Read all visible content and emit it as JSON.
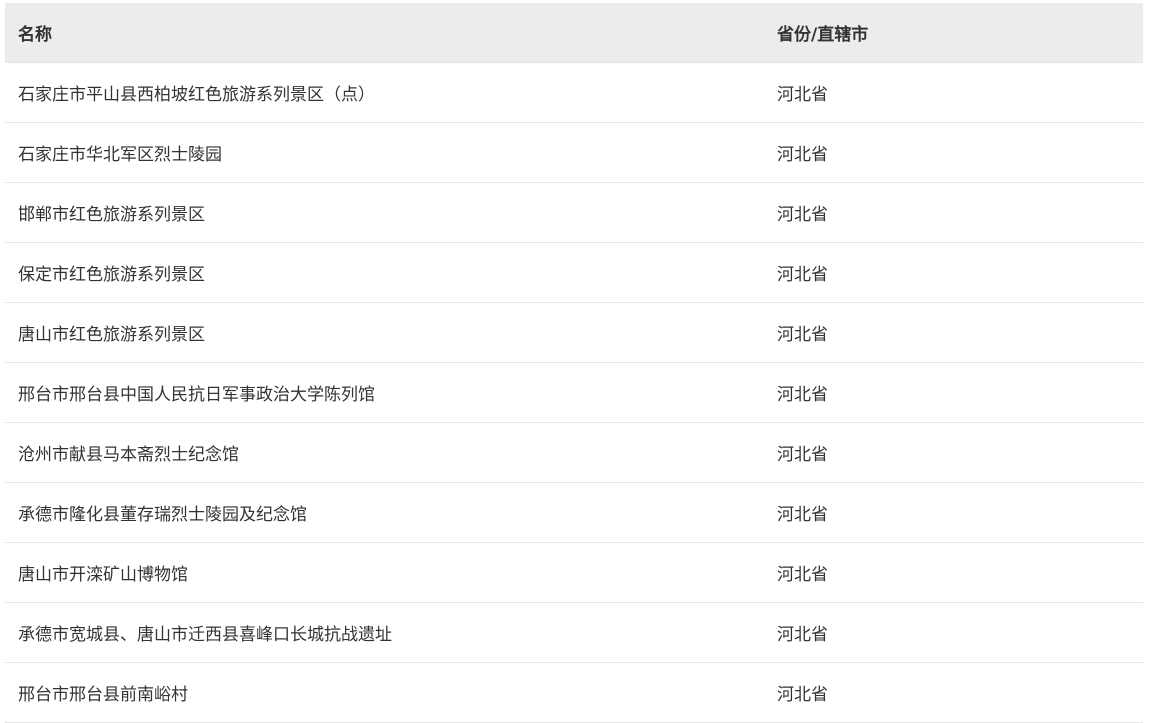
{
  "table": {
    "headers": {
      "name": "名称",
      "province": "省份/直辖市"
    },
    "rows": [
      {
        "name": "石家庄市平山县西柏坡红色旅游系列景区（点）",
        "province": "河北省"
      },
      {
        "name": "石家庄市华北军区烈士陵园",
        "province": "河北省"
      },
      {
        "name": "邯郸市红色旅游系列景区",
        "province": "河北省"
      },
      {
        "name": "保定市红色旅游系列景区",
        "province": "河北省"
      },
      {
        "name": "唐山市红色旅游系列景区",
        "province": "河北省"
      },
      {
        "name": "邢台市邢台县中国人民抗日军事政治大学陈列馆",
        "province": "河北省"
      },
      {
        "name": "沧州市献县马本斋烈士纪念馆",
        "province": "河北省"
      },
      {
        "name": "承德市隆化县董存瑞烈士陵园及纪念馆",
        "province": "河北省"
      },
      {
        "name": "唐山市开滦矿山博物馆",
        "province": "河北省"
      },
      {
        "name": "承德市宽城县、唐山市迁西县喜峰口长城抗战遗址",
        "province": "河北省"
      },
      {
        "name": "邢台市邢台县前南峪村",
        "province": "河北省"
      }
    ]
  }
}
